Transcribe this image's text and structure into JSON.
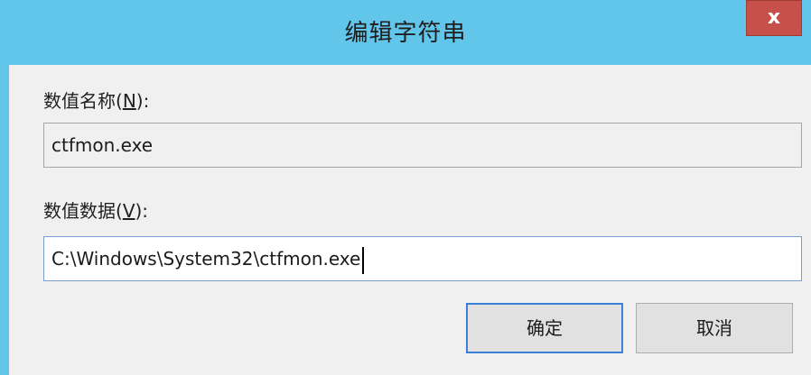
{
  "window": {
    "title": "编辑字符串",
    "close_label": "x"
  },
  "value_name": {
    "label": "数值名称(",
    "accel": "N",
    "label_end": "):",
    "value": "ctfmon.exe"
  },
  "value_data": {
    "label": "数值数据(",
    "accel": "V",
    "label_end": "):",
    "value": "C:\\Windows\\System32\\ctfmon.exe"
  },
  "buttons": {
    "ok": "确定",
    "cancel": "取消"
  },
  "colors": {
    "titlebar": "#62c6ea",
    "close": "#c7504b",
    "background": "#f0f0f0"
  }
}
